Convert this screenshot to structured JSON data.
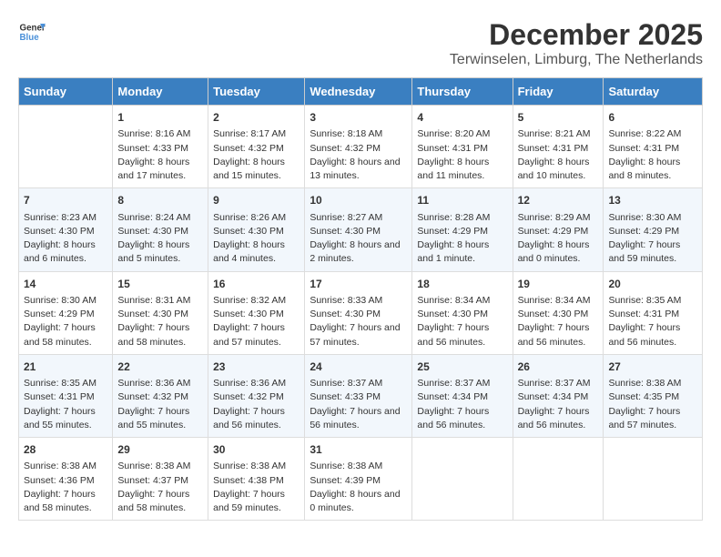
{
  "logo": {
    "line1": "General",
    "line2": "Blue"
  },
  "title": "December 2025",
  "location": "Terwinselen, Limburg, The Netherlands",
  "days_of_week": [
    "Sunday",
    "Monday",
    "Tuesday",
    "Wednesday",
    "Thursday",
    "Friday",
    "Saturday"
  ],
  "weeks": [
    [
      {
        "day": "",
        "rise": "",
        "set": "",
        "daylight": ""
      },
      {
        "day": "1",
        "rise": "Sunrise: 8:16 AM",
        "set": "Sunset: 4:33 PM",
        "daylight": "Daylight: 8 hours and 17 minutes."
      },
      {
        "day": "2",
        "rise": "Sunrise: 8:17 AM",
        "set": "Sunset: 4:32 PM",
        "daylight": "Daylight: 8 hours and 15 minutes."
      },
      {
        "day": "3",
        "rise": "Sunrise: 8:18 AM",
        "set": "Sunset: 4:32 PM",
        "daylight": "Daylight: 8 hours and 13 minutes."
      },
      {
        "day": "4",
        "rise": "Sunrise: 8:20 AM",
        "set": "Sunset: 4:31 PM",
        "daylight": "Daylight: 8 hours and 11 minutes."
      },
      {
        "day": "5",
        "rise": "Sunrise: 8:21 AM",
        "set": "Sunset: 4:31 PM",
        "daylight": "Daylight: 8 hours and 10 minutes."
      },
      {
        "day": "6",
        "rise": "Sunrise: 8:22 AM",
        "set": "Sunset: 4:31 PM",
        "daylight": "Daylight: 8 hours and 8 minutes."
      }
    ],
    [
      {
        "day": "7",
        "rise": "Sunrise: 8:23 AM",
        "set": "Sunset: 4:30 PM",
        "daylight": "Daylight: 8 hours and 6 minutes."
      },
      {
        "day": "8",
        "rise": "Sunrise: 8:24 AM",
        "set": "Sunset: 4:30 PM",
        "daylight": "Daylight: 8 hours and 5 minutes."
      },
      {
        "day": "9",
        "rise": "Sunrise: 8:26 AM",
        "set": "Sunset: 4:30 PM",
        "daylight": "Daylight: 8 hours and 4 minutes."
      },
      {
        "day": "10",
        "rise": "Sunrise: 8:27 AM",
        "set": "Sunset: 4:30 PM",
        "daylight": "Daylight: 8 hours and 2 minutes."
      },
      {
        "day": "11",
        "rise": "Sunrise: 8:28 AM",
        "set": "Sunset: 4:29 PM",
        "daylight": "Daylight: 8 hours and 1 minute."
      },
      {
        "day": "12",
        "rise": "Sunrise: 8:29 AM",
        "set": "Sunset: 4:29 PM",
        "daylight": "Daylight: 8 hours and 0 minutes."
      },
      {
        "day": "13",
        "rise": "Sunrise: 8:30 AM",
        "set": "Sunset: 4:29 PM",
        "daylight": "Daylight: 7 hours and 59 minutes."
      }
    ],
    [
      {
        "day": "14",
        "rise": "Sunrise: 8:30 AM",
        "set": "Sunset: 4:29 PM",
        "daylight": "Daylight: 7 hours and 58 minutes."
      },
      {
        "day": "15",
        "rise": "Sunrise: 8:31 AM",
        "set": "Sunset: 4:30 PM",
        "daylight": "Daylight: 7 hours and 58 minutes."
      },
      {
        "day": "16",
        "rise": "Sunrise: 8:32 AM",
        "set": "Sunset: 4:30 PM",
        "daylight": "Daylight: 7 hours and 57 minutes."
      },
      {
        "day": "17",
        "rise": "Sunrise: 8:33 AM",
        "set": "Sunset: 4:30 PM",
        "daylight": "Daylight: 7 hours and 57 minutes."
      },
      {
        "day": "18",
        "rise": "Sunrise: 8:34 AM",
        "set": "Sunset: 4:30 PM",
        "daylight": "Daylight: 7 hours and 56 minutes."
      },
      {
        "day": "19",
        "rise": "Sunrise: 8:34 AM",
        "set": "Sunset: 4:30 PM",
        "daylight": "Daylight: 7 hours and 56 minutes."
      },
      {
        "day": "20",
        "rise": "Sunrise: 8:35 AM",
        "set": "Sunset: 4:31 PM",
        "daylight": "Daylight: 7 hours and 56 minutes."
      }
    ],
    [
      {
        "day": "21",
        "rise": "Sunrise: 8:35 AM",
        "set": "Sunset: 4:31 PM",
        "daylight": "Daylight: 7 hours and 55 minutes."
      },
      {
        "day": "22",
        "rise": "Sunrise: 8:36 AM",
        "set": "Sunset: 4:32 PM",
        "daylight": "Daylight: 7 hours and 55 minutes."
      },
      {
        "day": "23",
        "rise": "Sunrise: 8:36 AM",
        "set": "Sunset: 4:32 PM",
        "daylight": "Daylight: 7 hours and 56 minutes."
      },
      {
        "day": "24",
        "rise": "Sunrise: 8:37 AM",
        "set": "Sunset: 4:33 PM",
        "daylight": "Daylight: 7 hours and 56 minutes."
      },
      {
        "day": "25",
        "rise": "Sunrise: 8:37 AM",
        "set": "Sunset: 4:34 PM",
        "daylight": "Daylight: 7 hours and 56 minutes."
      },
      {
        "day": "26",
        "rise": "Sunrise: 8:37 AM",
        "set": "Sunset: 4:34 PM",
        "daylight": "Daylight: 7 hours and 56 minutes."
      },
      {
        "day": "27",
        "rise": "Sunrise: 8:38 AM",
        "set": "Sunset: 4:35 PM",
        "daylight": "Daylight: 7 hours and 57 minutes."
      }
    ],
    [
      {
        "day": "28",
        "rise": "Sunrise: 8:38 AM",
        "set": "Sunset: 4:36 PM",
        "daylight": "Daylight: 7 hours and 58 minutes."
      },
      {
        "day": "29",
        "rise": "Sunrise: 8:38 AM",
        "set": "Sunset: 4:37 PM",
        "daylight": "Daylight: 7 hours and 58 minutes."
      },
      {
        "day": "30",
        "rise": "Sunrise: 8:38 AM",
        "set": "Sunset: 4:38 PM",
        "daylight": "Daylight: 7 hours and 59 minutes."
      },
      {
        "day": "31",
        "rise": "Sunrise: 8:38 AM",
        "set": "Sunset: 4:39 PM",
        "daylight": "Daylight: 8 hours and 0 minutes."
      },
      {
        "day": "",
        "rise": "",
        "set": "",
        "daylight": ""
      },
      {
        "day": "",
        "rise": "",
        "set": "",
        "daylight": ""
      },
      {
        "day": "",
        "rise": "",
        "set": "",
        "daylight": ""
      }
    ]
  ]
}
